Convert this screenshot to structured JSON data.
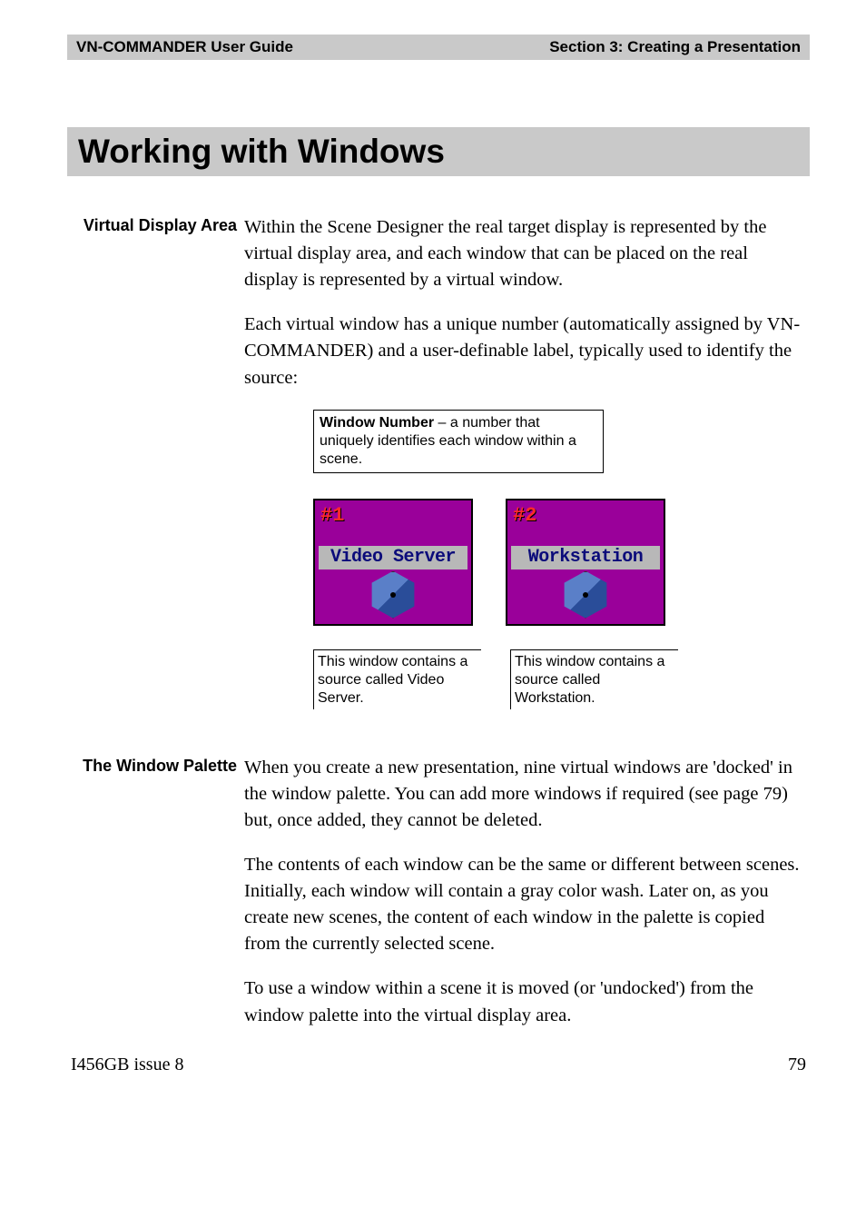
{
  "header": {
    "left": "VN-COMMANDER User Guide",
    "right": "Section 3: Creating a Presentation"
  },
  "title": "Working with Windows",
  "sections": {
    "vda": {
      "label": "Virtual Display Area",
      "p1": "Within the Scene Designer the real target display is represented by the virtual display area, and each window that can be placed on the real display is represented by a virtual window.",
      "p2": "Each virtual window has a unique number (automatically assigned by VN-COMMANDER) and a user-definable label, typically used to identify the source:"
    },
    "palette": {
      "label": "The Window Palette",
      "p1": "When you create a new presentation, nine virtual windows are 'docked' in the window palette. You can add more windows if required (see page 79) but, once added, they cannot be deleted.",
      "p2": "The contents of each window can be the same or different between scenes. Initially, each window will contain a gray color wash. Later on, as you create new scenes, the content of each window in the palette is copied from the currently selected scene.",
      "p3": "To use a window within a scene it is moved (or 'undocked') from the window palette into the virtual display area."
    }
  },
  "figure": {
    "callout_top_bold": "Window Number",
    "callout_top_rest": " – a number that uniquely identifies each window within a scene.",
    "thumbs": [
      {
        "num": "#1",
        "label": "Video Server",
        "caption": "This window contains a source called Video Server."
      },
      {
        "num": "#2",
        "label": "Workstation",
        "caption": "This window contains a source called Workstation."
      }
    ]
  },
  "footer": {
    "left": "I456GB issue 8",
    "right": "79"
  }
}
